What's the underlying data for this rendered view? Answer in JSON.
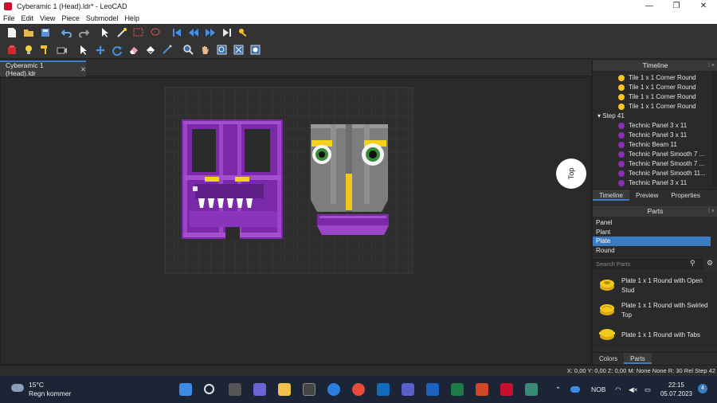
{
  "window": {
    "title": "Cyberamic 1 (Head).ldr* - LeoCAD",
    "controls": [
      "—",
      "❐",
      "✕"
    ]
  },
  "menu": [
    "File",
    "Edit",
    "View",
    "Piece",
    "Submodel",
    "Help"
  ],
  "toolbar1": [
    "new-file",
    "open-folder",
    "save",
    "undo",
    "redo",
    "select-arrow",
    "magic-wand",
    "region-select",
    "lasso",
    "first-step",
    "previous-step",
    "next-step",
    "last-step",
    "key"
  ],
  "toolbar2": [
    "brick",
    "light-bulb",
    "paint-roller",
    "camera",
    "select-cursor",
    "move",
    "rotate",
    "eraser",
    "paint",
    "pick-color",
    "zoom",
    "pan",
    "zoom-region",
    "zoom-extents",
    "roll"
  ],
  "tab": {
    "label": "Cyberamic 1 (Head).ldr",
    "close": "✕"
  },
  "viewcube": {
    "label": "Top"
  },
  "timeline": {
    "header": "Timeline",
    "pin": "⁞ ×",
    "rows": [
      {
        "kind": "part",
        "label": "Tile  1 x  1 Corner Round",
        "color": "#f7c81b"
      },
      {
        "kind": "part",
        "label": "Tile  1 x  1 Corner Round",
        "color": "#f7c81b"
      },
      {
        "kind": "part",
        "label": "Tile  1 x  1 Corner Round",
        "color": "#f7c81b"
      },
      {
        "kind": "part",
        "label": "Tile  1 x  1 Corner Round",
        "color": "#f7c81b"
      },
      {
        "kind": "step",
        "label": "Step 41"
      },
      {
        "kind": "part",
        "label": "Technic Panel  3 x 11",
        "color": "#8a2fb5"
      },
      {
        "kind": "part",
        "label": "Technic Panel  3 x 11",
        "color": "#8a2fb5"
      },
      {
        "kind": "part",
        "label": "Technic Beam 11",
        "color": "#8a2fb5"
      },
      {
        "kind": "part",
        "label": "Technic Panel Smooth  7 ...",
        "color": "#8a2fb5"
      },
      {
        "kind": "part",
        "label": "Technic Panel Smooth  7 ...",
        "color": "#8a2fb5"
      },
      {
        "kind": "part",
        "label": "Technic Panel Smooth 11...",
        "color": "#8a2fb5"
      },
      {
        "kind": "part",
        "label": "Technic Panel  3 x 11",
        "color": "#8a2fb5"
      }
    ]
  },
  "upper_tabs": [
    "Timeline",
    "Preview",
    "Properties"
  ],
  "parts": {
    "header": "Parts",
    "pin": "⁞ ×",
    "categories": [
      "Panel",
      "Plant",
      "Plate",
      "Round"
    ],
    "selected_category": "Plate",
    "search_placeholder": "Search Parts",
    "items": [
      {
        "name": "Plate  1 x  1 Round with Open Stud"
      },
      {
        "name": "Plate  1 x  1 Round with Swirled Top"
      },
      {
        "name": "Plate  1 x  1 Round with Tabs"
      }
    ]
  },
  "lower_tabs": [
    "Colors",
    "Parts"
  ],
  "status": {
    "text": "X: 0,00 Y: 0,00 Z: 0,00   M: None None R: 30 Rel  Step 42"
  },
  "taskbar": {
    "weather_temp": "15°C",
    "weather_desc": "Regn kommer",
    "tray_lang": "NOB",
    "time": "22:15",
    "date": "05.07.2023",
    "notifications": "4"
  }
}
